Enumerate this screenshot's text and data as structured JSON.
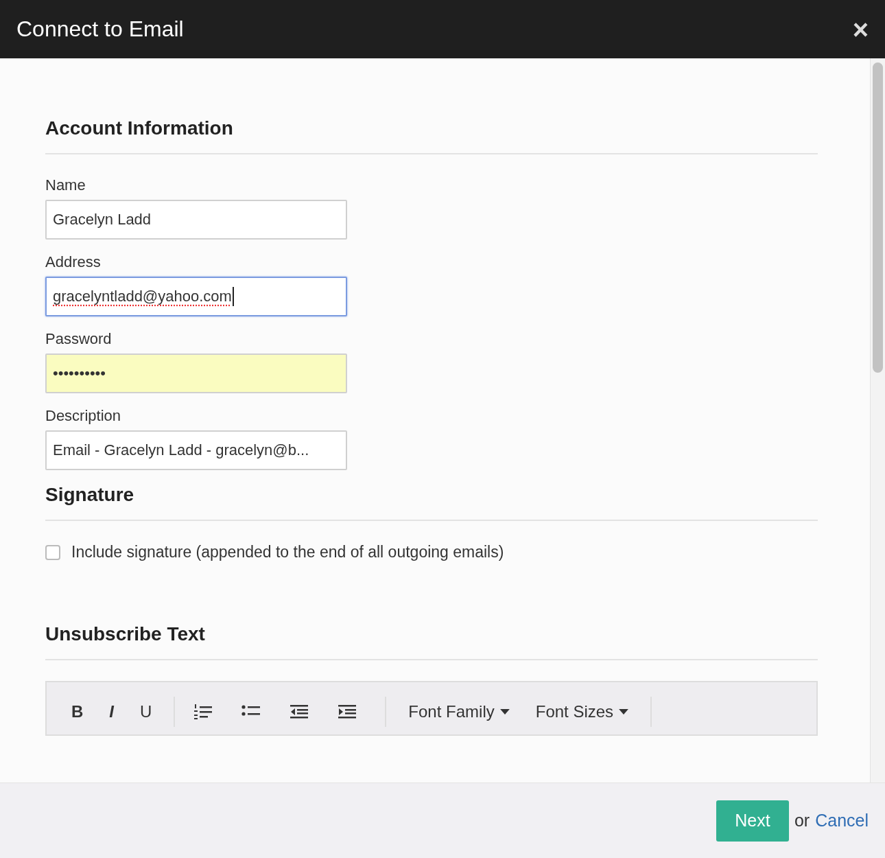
{
  "window": {
    "title": "Connect to Email",
    "close": "×"
  },
  "sections": [
    {
      "heading": "Account Information",
      "kind": "fields",
      "fields": [
        {
          "label": "Name",
          "value": "Gracelyn Ladd",
          "focused": false,
          "autofilled": false,
          "spellcheck_error": false
        },
        {
          "label": "Address",
          "value": "gracelyntladd@yahoo.com",
          "focused": true,
          "autofilled": false,
          "spellcheck_error": true
        },
        {
          "label": "Password",
          "value": "••••••••••",
          "focused": false,
          "autofilled": true,
          "spellcheck_error": false
        },
        {
          "label": "Description",
          "value": "Email - Gracelyn Ladd - gracelyn@b...",
          "focused": false,
          "autofilled": false,
          "spellcheck_error": false
        }
      ]
    },
    {
      "heading": "Signature",
      "kind": "checkbox",
      "checkbox": {
        "label": "Include signature (appended to the end of all outgoing emails)",
        "checked": false
      }
    },
    {
      "heading": "Unsubscribe Text",
      "kind": "editor",
      "toolbar": [
        {
          "kind": "bold",
          "label": "B"
        },
        {
          "kind": "italic",
          "label": "I"
        },
        {
          "kind": "underline",
          "label": "U"
        },
        {
          "kind": "separator"
        },
        {
          "kind": "ordered-list"
        },
        {
          "kind": "bullet-list"
        },
        {
          "kind": "outdent"
        },
        {
          "kind": "indent"
        },
        {
          "kind": "separator"
        },
        {
          "kind": "dropdown",
          "label": "Font Family"
        },
        {
          "kind": "dropdown",
          "label": "Font Sizes"
        },
        {
          "kind": "separator"
        }
      ]
    }
  ],
  "footer": {
    "primary": "Next",
    "joiner": "or",
    "cancel": "Cancel"
  }
}
